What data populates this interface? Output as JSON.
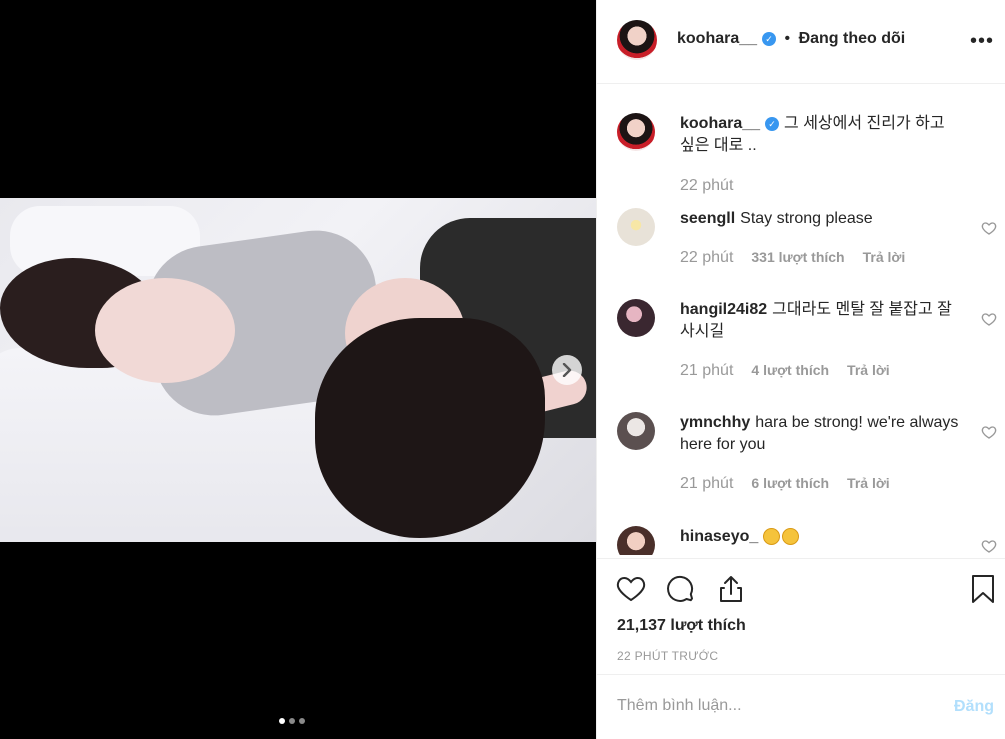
{
  "header": {
    "username": "koohara__",
    "separator": "•",
    "follow_label": "Đang theo dõi",
    "more_label": "•••"
  },
  "caption": {
    "username": "koohara__",
    "text": "그 세상에서 진리가 하고 싶은 대로 ..",
    "time": "22 phút"
  },
  "comments": [
    {
      "username": "seengll",
      "text": "Stay strong please",
      "time": "22 phút",
      "likes": "331 lượt thích",
      "reply": "Trả lời"
    },
    {
      "username": "hangil24i82",
      "text": "그대라도 멘탈 잘 붙잡고 잘 사시길",
      "time": "21 phút",
      "likes": "4 lượt thích",
      "reply": "Trả lời"
    },
    {
      "username": "ymnchhy",
      "text": "hara be strong! we're always here for you",
      "time": "21 phút",
      "likes": "6 lượt thích",
      "reply": "Trả lời"
    },
    {
      "username": "hinaseyo_",
      "text": ""
    }
  ],
  "actions": {
    "likes_count": "21,137 lượt thích",
    "posted_ago": "22 PHÚT TRƯỚC"
  },
  "add_comment": {
    "placeholder": "Thêm bình luận...",
    "post_label": "Đăng"
  },
  "carousel": {
    "total": 3,
    "active": 1
  },
  "colors": {
    "verified": "#3897f0",
    "post_disabled": "#b2dffc",
    "meta_gray": "#999999"
  }
}
